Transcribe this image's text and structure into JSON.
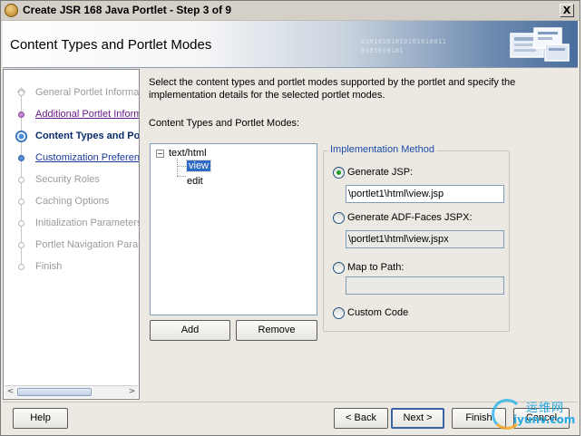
{
  "window": {
    "title": "Create JSR 168 Java Portlet - Step 3 of 9",
    "close_label": "X"
  },
  "header": {
    "title": "Content Types and Portlet Modes",
    "decoration_binary": "01010101010101010011 0101010101"
  },
  "nav": {
    "steps": [
      {
        "label": "General Portlet Information",
        "state": "disabled"
      },
      {
        "label": "Additional Portlet Information",
        "state": "visited"
      },
      {
        "label": "Content Types and Portlet Modes",
        "state": "current"
      },
      {
        "label": "Customization Preferences",
        "state": "todo"
      },
      {
        "label": "Security Roles",
        "state": "disabled"
      },
      {
        "label": "Caching Options",
        "state": "disabled"
      },
      {
        "label": "Initialization Parameters",
        "state": "disabled"
      },
      {
        "label": "Portlet Navigation Parameters",
        "state": "disabled"
      },
      {
        "label": "Finish",
        "state": "disabled"
      }
    ],
    "scroll_left": "<",
    "scroll_right": ">"
  },
  "content": {
    "description": "Select the content types and portlet modes supported by the portlet and specify the implementation details for the selected portlet modes.",
    "list_label": "Content Types and Portlet Modes:",
    "tree": {
      "root": "text/html",
      "expander": "−",
      "children": [
        "view",
        "edit"
      ]
    },
    "add_label": "Add",
    "remove_label": "Remove"
  },
  "implementation": {
    "legend": "Implementation Method",
    "options": [
      {
        "label": "Generate JSP:",
        "checked": true,
        "value": "\\portlet1\\html\\view.jsp"
      },
      {
        "label": "Generate ADF-Faces JSPX:",
        "checked": false,
        "value": "\\portlet1\\html\\view.jspx"
      },
      {
        "label": "Map to Path:",
        "checked": false,
        "value": ""
      },
      {
        "label": "Custom Code",
        "checked": false
      }
    ]
  },
  "footer": {
    "help_label": "Help",
    "back_label": "< Back",
    "next_label": "Next >",
    "finish_label": "Finish",
    "cancel_label": "Cancel"
  },
  "watermark": {
    "text_cn": "运维网",
    "url": "iyunv.com"
  },
  "colors": {
    "accent": "#316ac5",
    "link_visited": "#6a1a86",
    "link": "#1a3a9a",
    "legend": "#1a4aa8",
    "header_blue": "#4a6e9c"
  }
}
